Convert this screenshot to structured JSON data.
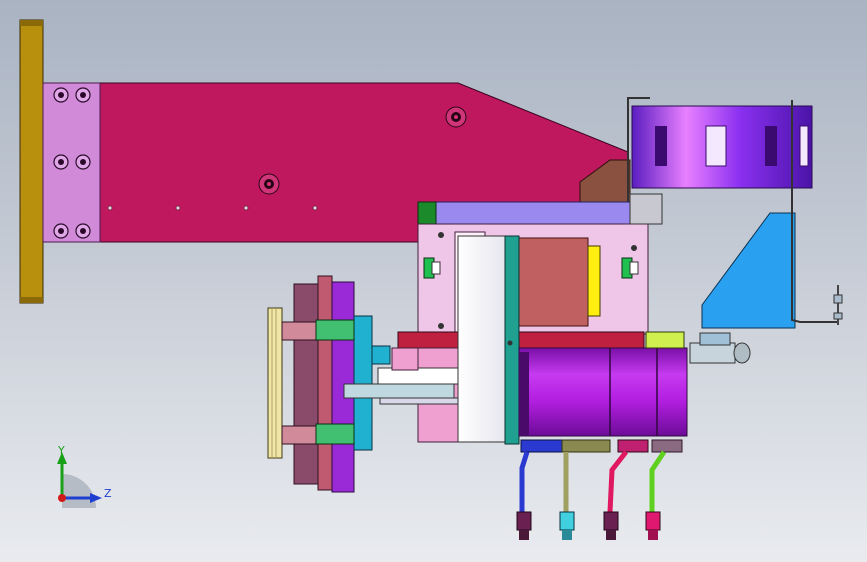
{
  "viewport": {
    "view": "Right view",
    "background_top": "#a9b3c2",
    "background_bottom": "#e9ebef"
  },
  "triad": {
    "y_label": "Y",
    "z_label": "Z",
    "y_color": "#19a019",
    "z_color": "#1f3fd0",
    "x_color": "#d01a1a"
  },
  "model": {
    "main_arm_color": "#c0185e",
    "mount_plate_color": "#b8900e",
    "mount_pad_color": "#d18ad8",
    "motor_color": "#b21fe0",
    "cable_clip_color": "#7a2ee8",
    "bracket_color": "#2aa0f0",
    "gripper_color": "#8a4a6a"
  }
}
